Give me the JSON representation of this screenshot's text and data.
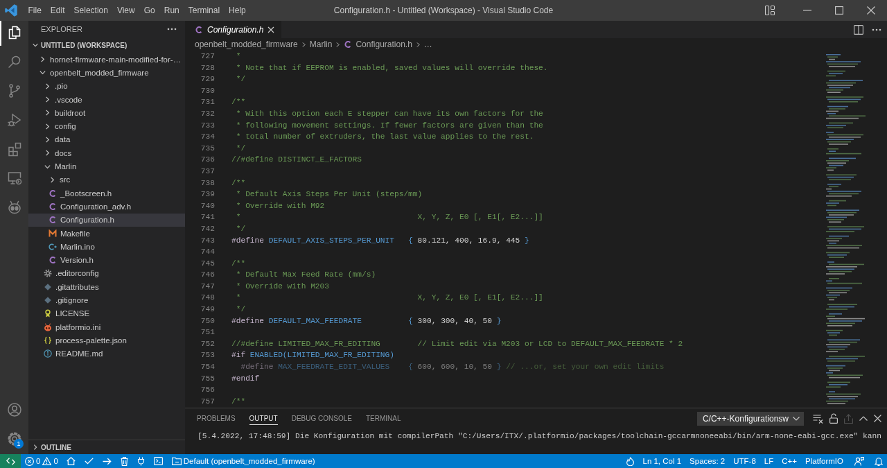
{
  "title_bar": {
    "menu": [
      "File",
      "Edit",
      "Selection",
      "View",
      "Go",
      "Run",
      "Terminal",
      "Help"
    ],
    "title": "Configuration.h - Untitled (Workspace) - Visual Studio Code"
  },
  "activity_bar": {
    "top": [
      {
        "kind": "explorer",
        "selected": true
      },
      {
        "kind": "search",
        "selected": false
      },
      {
        "kind": "source-control",
        "selected": false
      },
      {
        "kind": "run-debug",
        "selected": false
      },
      {
        "kind": "extensions",
        "selected": false
      },
      {
        "kind": "remote-explorer",
        "selected": false
      },
      {
        "kind": "platformio",
        "selected": false
      }
    ],
    "bottom": [
      {
        "kind": "account"
      },
      {
        "kind": "manage",
        "badge": "1"
      }
    ]
  },
  "explorer": {
    "title": "EXPLORER",
    "workspace": {
      "title": "UNTITLED (WORKSPACE)",
      "expanded": true,
      "items": [
        {
          "label": "hornet-firmware-main-modified-for-…",
          "kind": "folder",
          "expanded": false,
          "selected": false
        },
        {
          "label": "openbelt_modded_firmware",
          "kind": "folder",
          "expanded": true,
          "selected": false,
          "children": [
            {
              "label": ".pio",
              "kind": "folder",
              "expanded": false,
              "selected": false
            },
            {
              "label": ".vscode",
              "kind": "folder",
              "expanded": false,
              "selected": false
            },
            {
              "label": "buildroot",
              "kind": "folder",
              "expanded": false,
              "selected": false
            },
            {
              "label": "config",
              "kind": "folder",
              "expanded": false,
              "selected": false
            },
            {
              "label": "data",
              "kind": "folder",
              "expanded": false,
              "selected": false
            },
            {
              "label": "docs",
              "kind": "folder",
              "expanded": false,
              "selected": false
            },
            {
              "label": "Marlin",
              "kind": "folder",
              "expanded": true,
              "selected": false,
              "children": [
                {
                  "label": "src",
                  "kind": "folder",
                  "expanded": false,
                  "selected": false
                },
                {
                  "label": "_Bootscreen.h",
                  "kind": "c",
                  "selected": false
                },
                {
                  "label": "Configuration_adv.h",
                  "kind": "c",
                  "selected": false
                },
                {
                  "label": "Configuration.h",
                  "kind": "c",
                  "selected": true
                },
                {
                  "label": "Makefile",
                  "kind": "makefile",
                  "selected": false
                },
                {
                  "label": "Marlin.ino",
                  "kind": "arduino",
                  "selected": false
                },
                {
                  "label": "Version.h",
                  "kind": "c",
                  "selected": false
                }
              ]
            },
            {
              "label": ".editorconfig",
              "kind": "editorconfig",
              "selected": false
            },
            {
              "label": ".gitattributes",
              "kind": "git",
              "selected": false
            },
            {
              "label": ".gitignore",
              "kind": "git",
              "selected": false
            },
            {
              "label": "LICENSE",
              "kind": "license",
              "selected": false
            },
            {
              "label": "platformio.ini",
              "kind": "platformio",
              "selected": false
            },
            {
              "label": "process-palette.json",
              "kind": "json",
              "selected": false
            },
            {
              "label": "README.md",
              "kind": "info",
              "selected": false
            }
          ]
        }
      ]
    },
    "outline": {
      "title": "OUTLINE",
      "expanded": false
    }
  },
  "editor": {
    "tabs": [
      {
        "label": "Configuration.h",
        "kind": "c",
        "selected": true,
        "preview": true
      }
    ],
    "breadcrumbs": [
      {
        "label": "openbelt_modded_firmware",
        "kind": "folder"
      },
      {
        "label": "Marlin",
        "kind": "folder"
      },
      {
        "label": "Configuration.h",
        "kind": "c"
      },
      {
        "label": "…",
        "kind": "symbol"
      }
    ],
    "lines": [
      {
        "number": "727",
        "dimmed": false,
        "segments": [
          {
            "kind": "comment",
            "text": " *"
          }
        ]
      },
      {
        "number": "728",
        "dimmed": false,
        "segments": [
          {
            "kind": "comment",
            "text": " * Note that if EEPROM is enabled, saved values will override these."
          }
        ]
      },
      {
        "number": "729",
        "dimmed": false,
        "segments": [
          {
            "kind": "comment",
            "text": " */"
          }
        ]
      },
      {
        "number": "730"
      },
      {
        "number": "731",
        "dimmed": false,
        "segments": [
          {
            "kind": "comment",
            "text": "/**"
          }
        ]
      },
      {
        "number": "732",
        "dimmed": false,
        "segments": [
          {
            "kind": "comment",
            "text": " * With this option each E stepper can have its own factors for the"
          }
        ]
      },
      {
        "number": "733",
        "dimmed": false,
        "segments": [
          {
            "kind": "comment",
            "text": " * following movement settings. If fewer factors are given than the"
          }
        ]
      },
      {
        "number": "734",
        "dimmed": false,
        "segments": [
          {
            "kind": "comment",
            "text": " * total number of extruders, the last value applies to the rest."
          }
        ]
      },
      {
        "number": "735",
        "dimmed": false,
        "segments": [
          {
            "kind": "comment",
            "text": " */"
          }
        ]
      },
      {
        "number": "736",
        "dimmed": false,
        "segments": [
          {
            "kind": "comment",
            "text": "//#define DISTINCT_E_FACTORS"
          }
        ]
      },
      {
        "number": "737"
      },
      {
        "number": "738",
        "dimmed": false,
        "segments": [
          {
            "kind": "comment",
            "text": "/**"
          }
        ]
      },
      {
        "number": "739",
        "dimmed": false,
        "segments": [
          {
            "kind": "comment",
            "text": " * Default Axis Steps Per Unit (steps/mm)"
          }
        ]
      },
      {
        "number": "740",
        "dimmed": false,
        "segments": [
          {
            "kind": "comment",
            "text": " * Override with M92"
          }
        ]
      },
      {
        "number": "741",
        "dimmed": false,
        "segments": [
          {
            "kind": "comment",
            "text": " *                                      X, Y, Z, E0 [, E1[, E2...]]"
          }
        ]
      },
      {
        "number": "742",
        "dimmed": false,
        "segments": [
          {
            "kind": "comment",
            "text": " */"
          }
        ]
      },
      {
        "number": "743",
        "dimmed": false,
        "segments": [
          {
            "kind": "directive",
            "text": "#define "
          },
          {
            "kind": "macro",
            "text": "DEFAULT_AXIS_STEPS_PER_UNIT   "
          },
          {
            "kind": "brace",
            "text": "{"
          },
          {
            "kind": "value",
            "text": " 80.121, 400, 16.9, 445 "
          },
          {
            "kind": "brace",
            "text": "}"
          }
        ]
      },
      {
        "number": "744"
      },
      {
        "number": "745",
        "dimmed": false,
        "segments": [
          {
            "kind": "comment",
            "text": "/**"
          }
        ]
      },
      {
        "number": "746",
        "dimmed": false,
        "segments": [
          {
            "kind": "comment",
            "text": " * Default Max Feed Rate (mm/s)"
          }
        ]
      },
      {
        "number": "747",
        "dimmed": false,
        "segments": [
          {
            "kind": "comment",
            "text": " * Override with M203"
          }
        ]
      },
      {
        "number": "748",
        "dimmed": false,
        "segments": [
          {
            "kind": "comment",
            "text": " *                                      X, Y, Z, E0 [, E1[, E2...]]"
          }
        ]
      },
      {
        "number": "749",
        "dimmed": false,
        "segments": [
          {
            "kind": "comment",
            "text": " */"
          }
        ]
      },
      {
        "number": "750",
        "dimmed": false,
        "segments": [
          {
            "kind": "directive",
            "text": "#define "
          },
          {
            "kind": "macro",
            "text": "DEFAULT_MAX_FEEDRATE          "
          },
          {
            "kind": "brace",
            "text": "{"
          },
          {
            "kind": "value",
            "text": " 300, 300, 40, 50 "
          },
          {
            "kind": "brace",
            "text": "}"
          }
        ]
      },
      {
        "number": "751"
      },
      {
        "number": "752",
        "dimmed": false,
        "segments": [
          {
            "kind": "comment",
            "text": "//#define LIMITED_MAX_FR_EDITING        // Limit edit via M203 or LCD to DEFAULT_MAX_FEEDRATE * 2"
          }
        ]
      },
      {
        "number": "753",
        "dimmed": false,
        "segments": [
          {
            "kind": "directive",
            "text": "#if "
          },
          {
            "kind": "macro",
            "text": "ENABLED(LIMITED_MAX_FR_EDITING)"
          }
        ]
      },
      {
        "number": "754",
        "dimmed": true,
        "segments": [
          {
            "kind": "directive",
            "text": "  #define "
          },
          {
            "kind": "macro",
            "text": "MAX_FEEDRATE_EDIT_VALUES    "
          },
          {
            "kind": "brace",
            "text": "{"
          },
          {
            "kind": "value",
            "text": " 600, 600, 10, 50 "
          },
          {
            "kind": "brace",
            "text": "}"
          },
          {
            "kind": "comment",
            "text": " // ...or, set your own edit limits"
          }
        ]
      },
      {
        "number": "755",
        "dimmed": false,
        "segments": [
          {
            "kind": "directive",
            "text": "#endif"
          }
        ]
      },
      {
        "number": "756"
      },
      {
        "number": "757",
        "dimmed": false,
        "segments": [
          {
            "kind": "comment",
            "text": "/**"
          }
        ]
      }
    ]
  },
  "panel": {
    "tabs": [
      {
        "label": "PROBLEMS",
        "selected": false
      },
      {
        "label": "OUTPUT",
        "selected": true
      },
      {
        "label": "DEBUG CONSOLE",
        "selected": false
      },
      {
        "label": "TERMINAL",
        "selected": false
      }
    ],
    "channel": "C/C++-Konfigurationsw",
    "output": [
      "[5.4.2022, 17:48:59] Die Konfiguration mit compilerPath \"C:/Users/ITX/.platformio/packages/toolchain-gccarmnoneeabi/bin/arm-none-eabi-gcc.exe\" kann"
    ]
  },
  "status_bar": {
    "errors": "0",
    "warnings": "0",
    "environment": "Default (openbelt_modded_firmware)",
    "right": [
      "Ln 1, Col 1",
      "Spaces: 2",
      "UTF-8",
      "LF",
      "C++",
      "PlatformIO"
    ]
  }
}
